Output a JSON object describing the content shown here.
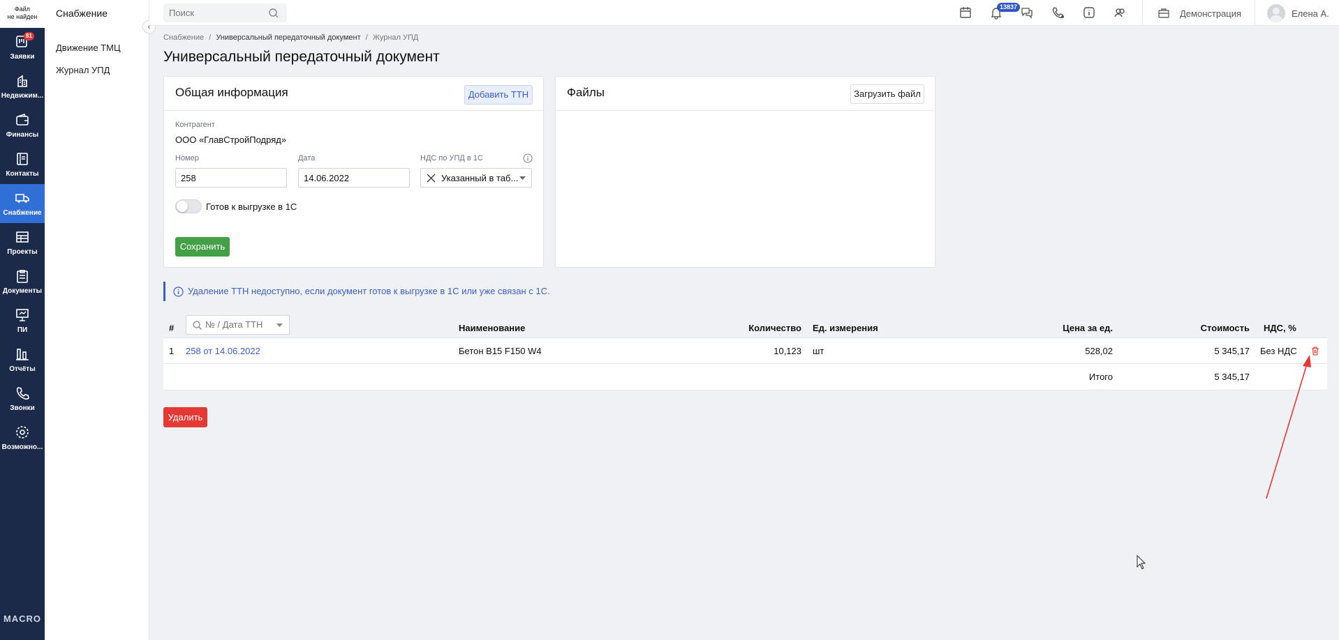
{
  "app": {
    "logo_text_line1": "Файл",
    "logo_text_line2": "не найден",
    "brand": "MACRO"
  },
  "leftnav": {
    "items": [
      {
        "label": "Заявки",
        "icon": "requests-icon",
        "badge": "81"
      },
      {
        "label": "Недвижим...",
        "icon": "building-icon"
      },
      {
        "label": "Финансы",
        "icon": "wallet-icon"
      },
      {
        "label": "Контакты",
        "icon": "contacts-book-icon"
      },
      {
        "label": "Снабжение",
        "icon": "truck-icon",
        "active": true
      },
      {
        "label": "Проекты",
        "icon": "projects-icon"
      },
      {
        "label": "Документы",
        "icon": "clipboard-icon"
      },
      {
        "label": "ПИ",
        "icon": "presentation-icon"
      },
      {
        "label": "Отчёты",
        "icon": "bar-chart-icon"
      },
      {
        "label": "Звонки",
        "icon": "phone-icon"
      },
      {
        "label": "Возможно...",
        "icon": "gear-icon"
      }
    ]
  },
  "subnav": {
    "title": "Снабжение",
    "items": [
      "Движение ТМЦ",
      "Журнал УПД"
    ]
  },
  "topbar": {
    "search_placeholder": "Поиск",
    "notifications_badge": "13837",
    "company": "Демонстрация",
    "user": "Елена А."
  },
  "breadcrumb": [
    "Снабжение",
    "Универсальный передаточный документ",
    "Журнал УПД"
  ],
  "page_title": "Универсальный передаточный документ",
  "general": {
    "title": "Общая информация",
    "add_ttn": "Добавить ТТН",
    "counterparty_label": "Контрагент",
    "counterparty": "ООО «ГлавСтройПодряд»",
    "number_label": "Номер",
    "number": "258",
    "date_label": "Дата",
    "date": "14.06.2022",
    "vat_label": "НДС по УПД в 1С",
    "vat_value": "Указанный в таб...",
    "ready_label": "Готов к выгрузке в 1С",
    "ready": false,
    "save": "Сохранить"
  },
  "files": {
    "title": "Файлы",
    "upload": "Загрузить файл"
  },
  "notice": "Удаление ТТН недоступно, если документ готов к выгрузке в 1С или уже связан с 1С.",
  "table": {
    "headers": {
      "num": "#",
      "filter_placeholder": "№ / Дата ТТН",
      "name": "Наименование",
      "qty": "Количество",
      "unit": "Ед. измерения",
      "price": "Цена за ед.",
      "cost": "Стоимость",
      "vat": "НДС, %"
    },
    "rows": [
      {
        "num": "1",
        "ttn": "258 от 14.06.2022",
        "name": "Бетон B15 F150 W4",
        "qty": "10,123",
        "unit": "шт",
        "price": "528,02",
        "cost": "5 345,17",
        "vat": "Без НДС"
      }
    ],
    "total_label": "Итого",
    "total": "5 345,17"
  },
  "delete_button": "Удалить",
  "colors": {
    "nav_bg": "#1c2a4a",
    "nav_active": "#2f6fd6",
    "save_green": "#43a047",
    "delete_red": "#e53935",
    "link_blue": "#3b5fc8"
  }
}
